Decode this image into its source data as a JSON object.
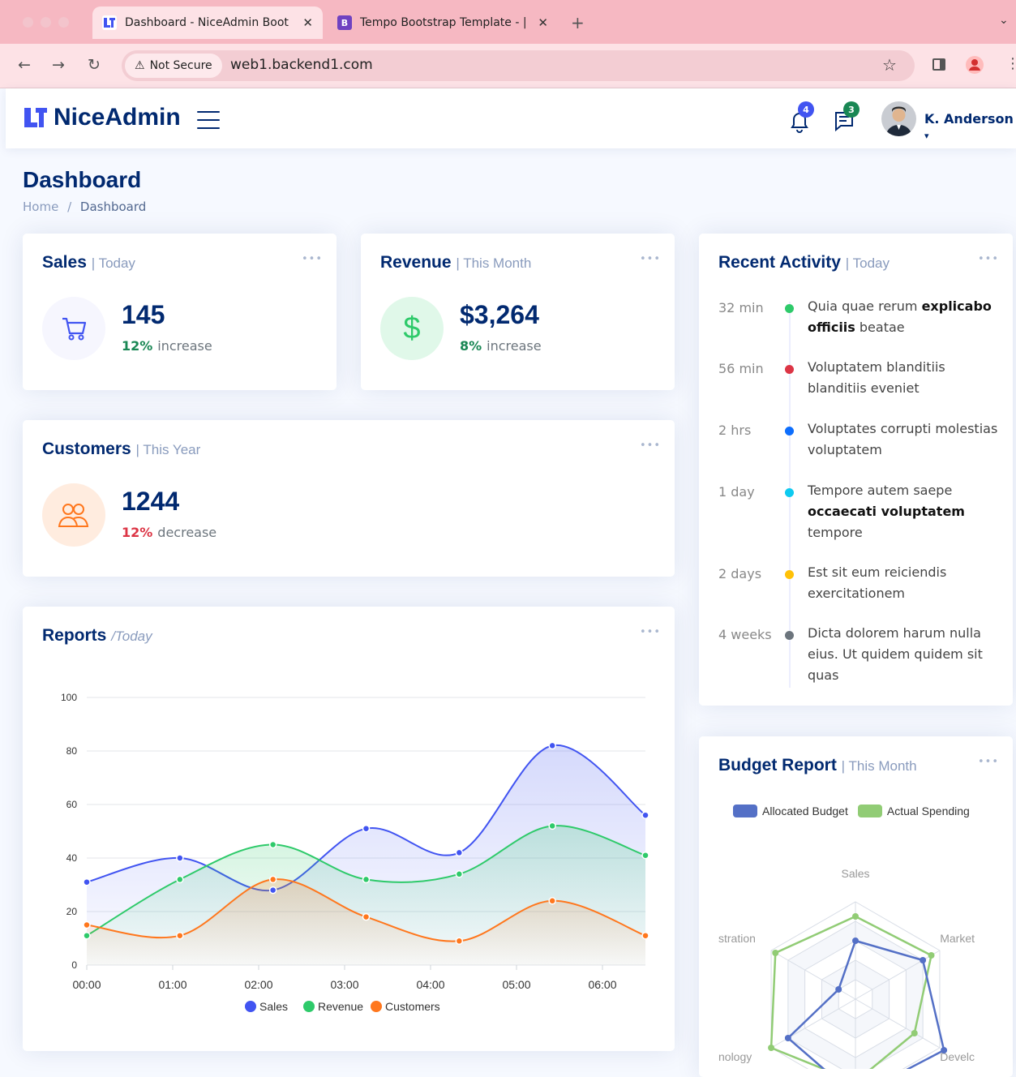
{
  "browser": {
    "tabs": [
      {
        "title": "Dashboard - NiceAdmin Boot",
        "favicon": "niceadmin-logo-icon",
        "active": true
      },
      {
        "title": "Tempo Bootstrap Template - |",
        "favicon": "bootstrap-b-icon",
        "active": false
      }
    ],
    "new_tab": "+",
    "security_label": "Not Secure",
    "url": "web1.backend1.com"
  },
  "header": {
    "brand": "NiceAdmin",
    "notifications_count": "4",
    "messages_count": "3",
    "user_name": "K. Anderson"
  },
  "page": {
    "title": "Dashboard",
    "breadcrumb": [
      "Home",
      "/",
      "Dashboard"
    ]
  },
  "sales_card": {
    "title": "Sales",
    "period": "| Today",
    "value": "145",
    "delta": "12%",
    "delta_label": "increase",
    "icon": "cart-icon"
  },
  "revenue_card": {
    "title": "Revenue",
    "period": "| This Month",
    "value": "$3,264",
    "delta": "8%",
    "delta_label": "increase",
    "icon": "dollar-icon"
  },
  "customers_card": {
    "title": "Customers",
    "period": "| This Year",
    "value": "1244",
    "delta": "12%",
    "delta_label": "decrease",
    "icon": "people-icon"
  },
  "reports": {
    "title": "Reports",
    "period": "/Today"
  },
  "activity": {
    "title": "Recent Activity",
    "period": "| Today",
    "items": [
      {
        "time": "32 min",
        "color": "#2eca6a",
        "pre": "Quia quae rerum ",
        "bold": "explicabo officiis",
        "post": " beatae"
      },
      {
        "time": "56 min",
        "color": "#dc3545",
        "pre": "Voluptatem blanditiis blanditiis eveniet",
        "bold": "",
        "post": ""
      },
      {
        "time": "2 hrs",
        "color": "#0d6efd",
        "pre": "Voluptates corrupti molestias voluptatem",
        "bold": "",
        "post": ""
      },
      {
        "time": "1 day",
        "color": "#0dcaf0",
        "pre": "Tempore autem saepe ",
        "bold": "occaecati voluptatem",
        "post": " tempore"
      },
      {
        "time": "2 days",
        "color": "#ffc107",
        "pre": "Est sit eum reiciendis exercitationem",
        "bold": "",
        "post": ""
      },
      {
        "time": "4 weeks",
        "color": "#6c757d",
        "pre": "Dicta dolorem harum nulla eius. Ut quidem quidem sit quas",
        "bold": "",
        "post": ""
      }
    ]
  },
  "budget": {
    "title": "Budget Report",
    "period": "| This Month"
  },
  "chart_data": [
    {
      "type": "area",
      "x": [
        "00:00",
        "01:30",
        "02:30",
        "03:30",
        "04:30",
        "05:30",
        "06:30"
      ],
      "x_ticks": [
        "00:00",
        "01:00",
        "02:00",
        "03:00",
        "04:00",
        "05:00",
        "06:00"
      ],
      "ylim": [
        0,
        100
      ],
      "y_ticks": [
        0,
        20,
        40,
        60,
        80,
        100
      ],
      "grid": true,
      "legend": "bottom",
      "series": [
        {
          "name": "Sales",
          "color": "#4154f1",
          "values": [
            31,
            40,
            28,
            51,
            42,
            82,
            56
          ]
        },
        {
          "name": "Revenue",
          "color": "#2eca6a",
          "values": [
            11,
            32,
            45,
            32,
            34,
            52,
            41
          ]
        },
        {
          "name": "Customers",
          "color": "#ff771d",
          "values": [
            15,
            11,
            32,
            18,
            9,
            24,
            11
          ]
        }
      ]
    },
    {
      "type": "radar",
      "axes": [
        "Sales",
        "Market",
        "Develc",
        "",
        "nology",
        "stration"
      ],
      "legend": "top",
      "series": [
        {
          "name": "Allocated Budget",
          "color": "#5470c6",
          "values": [
            0.6,
            0.8,
            1.05,
            1.0,
            0.8,
            0.2
          ]
        },
        {
          "name": "Actual Spending",
          "color": "#91cc75",
          "values": [
            0.85,
            0.9,
            0.7,
            0.85,
            1.0,
            0.95
          ]
        }
      ]
    }
  ]
}
